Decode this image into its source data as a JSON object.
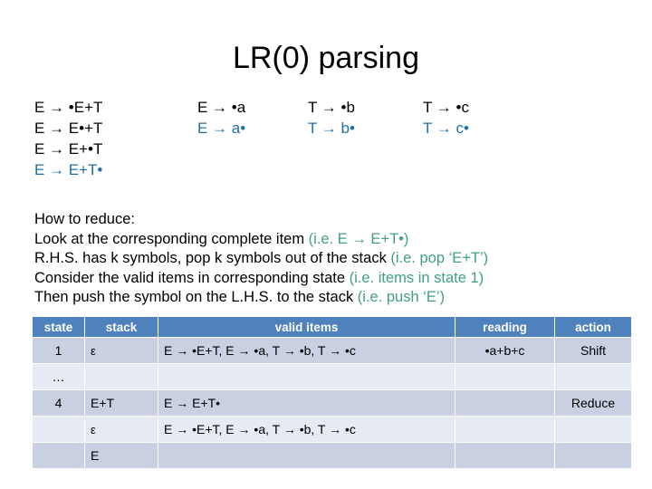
{
  "slide": {
    "title": "LR(0) parsing"
  },
  "items_grid": {
    "columns": [
      {
        "name": "column-e-dot-e-plus-t",
        "items": [
          {
            "text": "E → •E+T",
            "color": "black"
          },
          {
            "text": "E → E•+T",
            "color": "black"
          },
          {
            "text": "E → E+•T",
            "color": "black"
          },
          {
            "text": "E → E+T•",
            "color": "blue"
          }
        ]
      },
      {
        "name": "column-e-dot-a",
        "items": [
          {
            "text": "E → •a",
            "color": "black"
          },
          {
            "text": "E → a•",
            "color": "blue"
          }
        ]
      },
      {
        "name": "column-t-dot-b",
        "items": [
          {
            "text": "T → •b",
            "color": "black"
          },
          {
            "text": "T → b•",
            "color": "blue"
          }
        ]
      },
      {
        "name": "column-t-dot-c",
        "items": [
          {
            "text": "T → •c",
            "color": "black"
          },
          {
            "text": "T → c•",
            "color": "blue"
          }
        ]
      }
    ]
  },
  "explanation": {
    "heading": "How to reduce:",
    "lines": [
      {
        "dark": "Look at the corresponding complete item ",
        "green": "(i.e. E → E+T•)"
      },
      {
        "dark": "R.H.S. has k symbols, pop k symbols out  of the stack ",
        "green": "(i.e. pop ‘E+T’)"
      },
      {
        "dark": "Consider the valid items in corresponding state ",
        "green": "(i.e. items in state 1)"
      },
      {
        "dark": "Then push the symbol on the L.H.S. to the stack ",
        "green": "(i.e. push ‘E’)"
      }
    ]
  },
  "table": {
    "headers": [
      "state",
      "stack",
      "valid items",
      "reading",
      "action"
    ],
    "rows": [
      {
        "shade": "dark",
        "state": "1",
        "stack": "ε",
        "valid_items": "E → •E+T, E → •a, T → •b, T → •c",
        "reading": "•a+b+c",
        "action": "Shift"
      },
      {
        "shade": "light",
        "state": "…",
        "stack": "",
        "valid_items": "",
        "reading": "",
        "action": ""
      },
      {
        "shade": "dark",
        "state": "4",
        "stack": "E+T",
        "valid_items": "E → E+T•",
        "reading": "",
        "action": "Reduce"
      },
      {
        "shade": "light",
        "state": "",
        "stack": "ε",
        "valid_items": "E → •E+T, E → •a, T → •b, T → •c",
        "reading": "",
        "action": ""
      },
      {
        "shade": "dark",
        "state": "",
        "stack": "E",
        "valid_items": "",
        "reading": "",
        "action": ""
      }
    ]
  },
  "colors": {
    "header_blue": "#4F81BD",
    "row_dark": "#C8D0E2",
    "row_light": "#E6EAF3",
    "item_blue": "#1F6FA8",
    "annotation_green": "#41A084"
  }
}
